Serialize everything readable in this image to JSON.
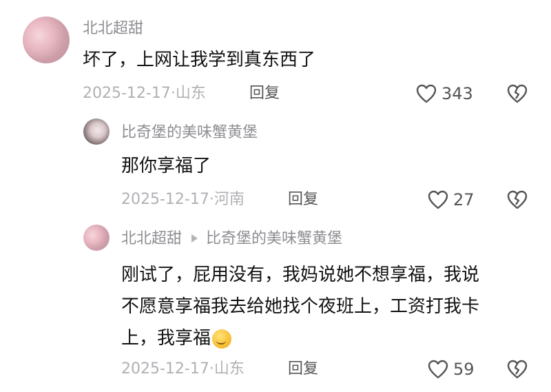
{
  "comments": [
    {
      "username": "北北超甜",
      "text": "坏了，上网让我学到真东西了",
      "meta": "2025-12-17·山东",
      "reply_label": "回复",
      "likes": "343"
    },
    {
      "username": "比奇堡的美味蟹黄堡",
      "text": "那你享福了",
      "meta": "2025-12-17·河南",
      "reply_label": "回复",
      "likes": "27"
    },
    {
      "username": "北北超甜",
      "reply_to": "比奇堡的美味蟹黄堡",
      "text_lines": [
        "刚试了，屁用没有，我妈说她不想享福，我说",
        "不愿意享福我去给她找个夜班上，工资打我卡",
        "上，我享福"
      ],
      "emoji": "smirk-face-emoji",
      "meta": "2025-12-17·山东",
      "reply_label": "回复",
      "likes": "59"
    }
  ],
  "icons": {
    "like": "heart-icon",
    "dislike": "broken-heart-icon",
    "reply_arrow": "triangle-right-icon"
  }
}
